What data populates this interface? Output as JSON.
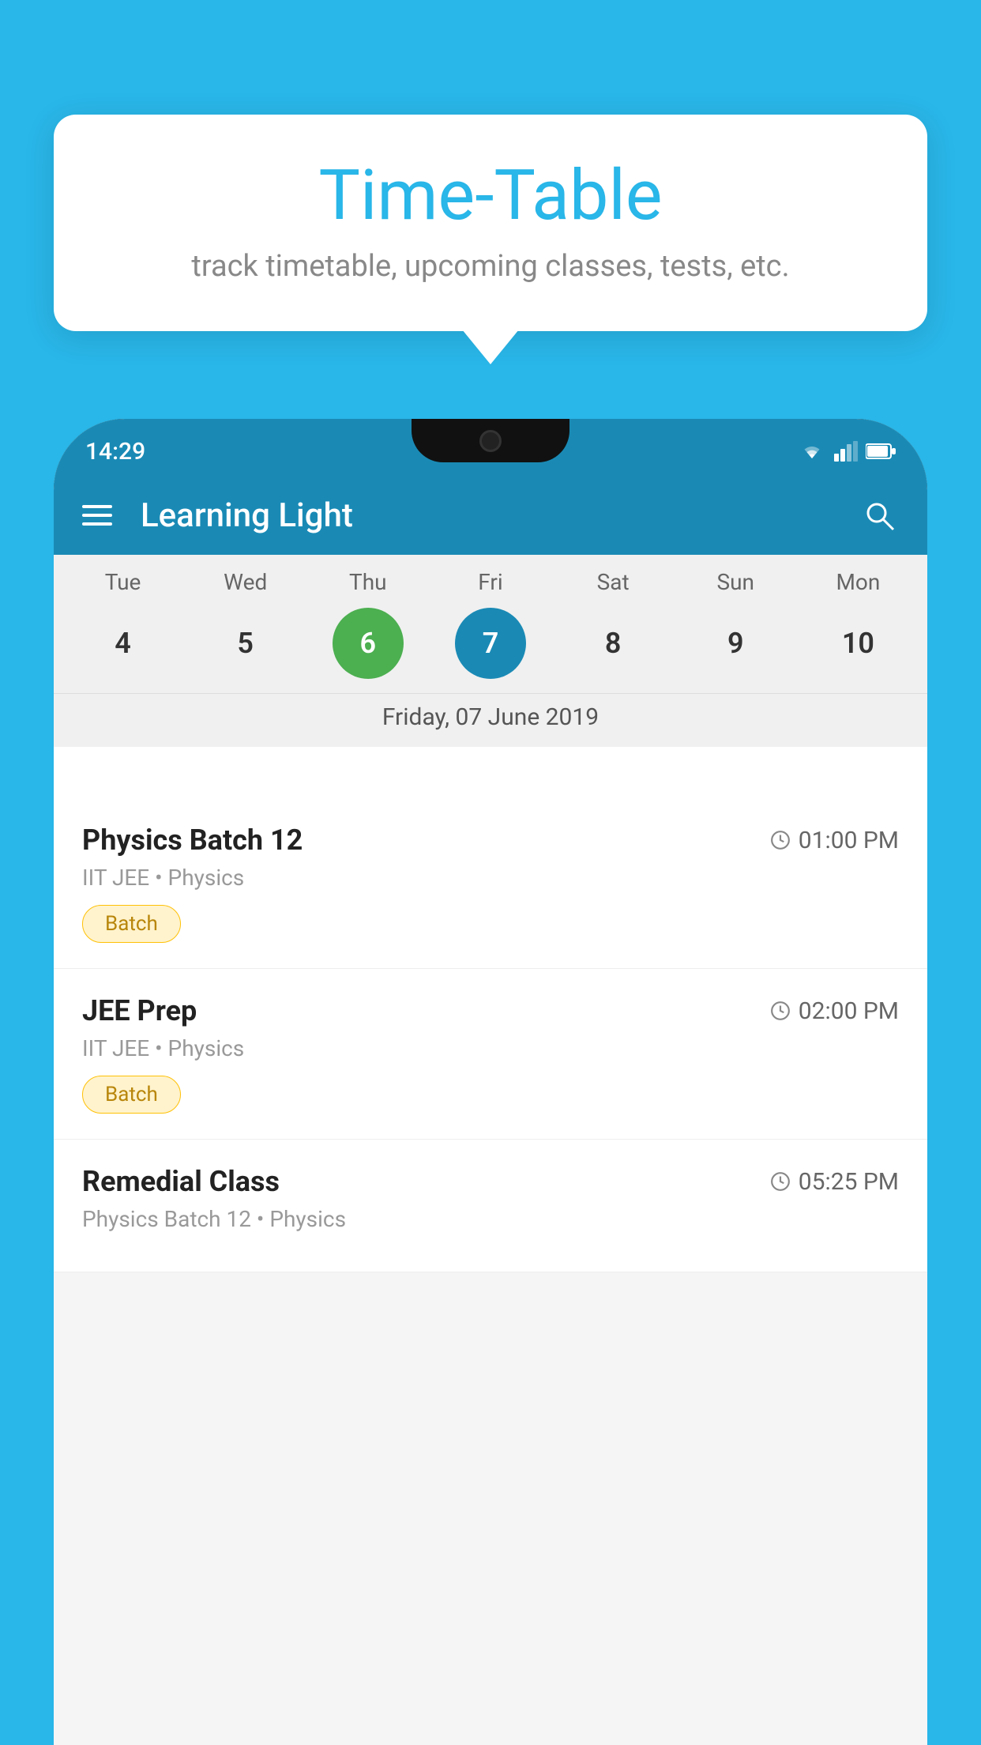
{
  "background_color": "#29b6e8",
  "tooltip": {
    "title": "Time-Table",
    "subtitle": "track timetable, upcoming classes, tests, etc."
  },
  "status_bar": {
    "time": "14:29"
  },
  "app_bar": {
    "title": "Learning Light"
  },
  "calendar": {
    "selected_date_label": "Friday, 07 June 2019",
    "weekdays": [
      "Tue",
      "Wed",
      "Thu",
      "Fri",
      "Sat",
      "Sun",
      "Mon"
    ],
    "dates": [
      {
        "number": "4",
        "state": "normal"
      },
      {
        "number": "5",
        "state": "normal"
      },
      {
        "number": "6",
        "state": "today"
      },
      {
        "number": "7",
        "state": "selected"
      },
      {
        "number": "8",
        "state": "normal"
      },
      {
        "number": "9",
        "state": "normal"
      },
      {
        "number": "10",
        "state": "normal"
      }
    ]
  },
  "schedule": [
    {
      "title": "Physics Batch 12",
      "time": "01:00 PM",
      "subtitle": "IIT JEE • Physics",
      "badge": "Batch"
    },
    {
      "title": "JEE Prep",
      "time": "02:00 PM",
      "subtitle": "IIT JEE • Physics",
      "badge": "Batch"
    },
    {
      "title": "Remedial Class",
      "time": "05:25 PM",
      "subtitle": "Physics Batch 12 • Physics",
      "badge": ""
    }
  ],
  "icons": {
    "hamburger": "☰",
    "search": "🔍",
    "clock": "🕐"
  }
}
